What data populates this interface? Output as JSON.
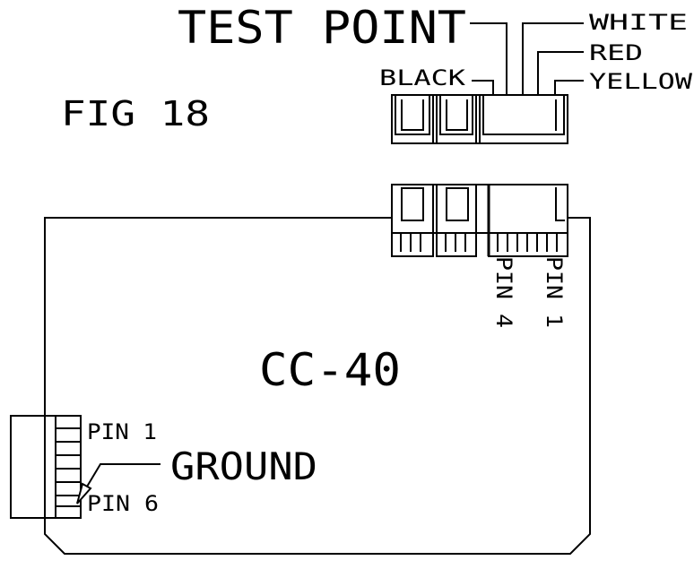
{
  "figure_label": "FIG 18",
  "board_label": "CC-40",
  "test_point_label": "TEST POINT",
  "wire_labels": {
    "white": "WHITE",
    "red": "RED",
    "yellow": "YELLOW",
    "black": "BLACK"
  },
  "pin_labels": {
    "top_pin4": "PIN 4",
    "top_pin1": "PIN 1",
    "left_pin1": "PIN 1",
    "left_pin6": "PIN 6"
  },
  "ground_label": "GROUND"
}
